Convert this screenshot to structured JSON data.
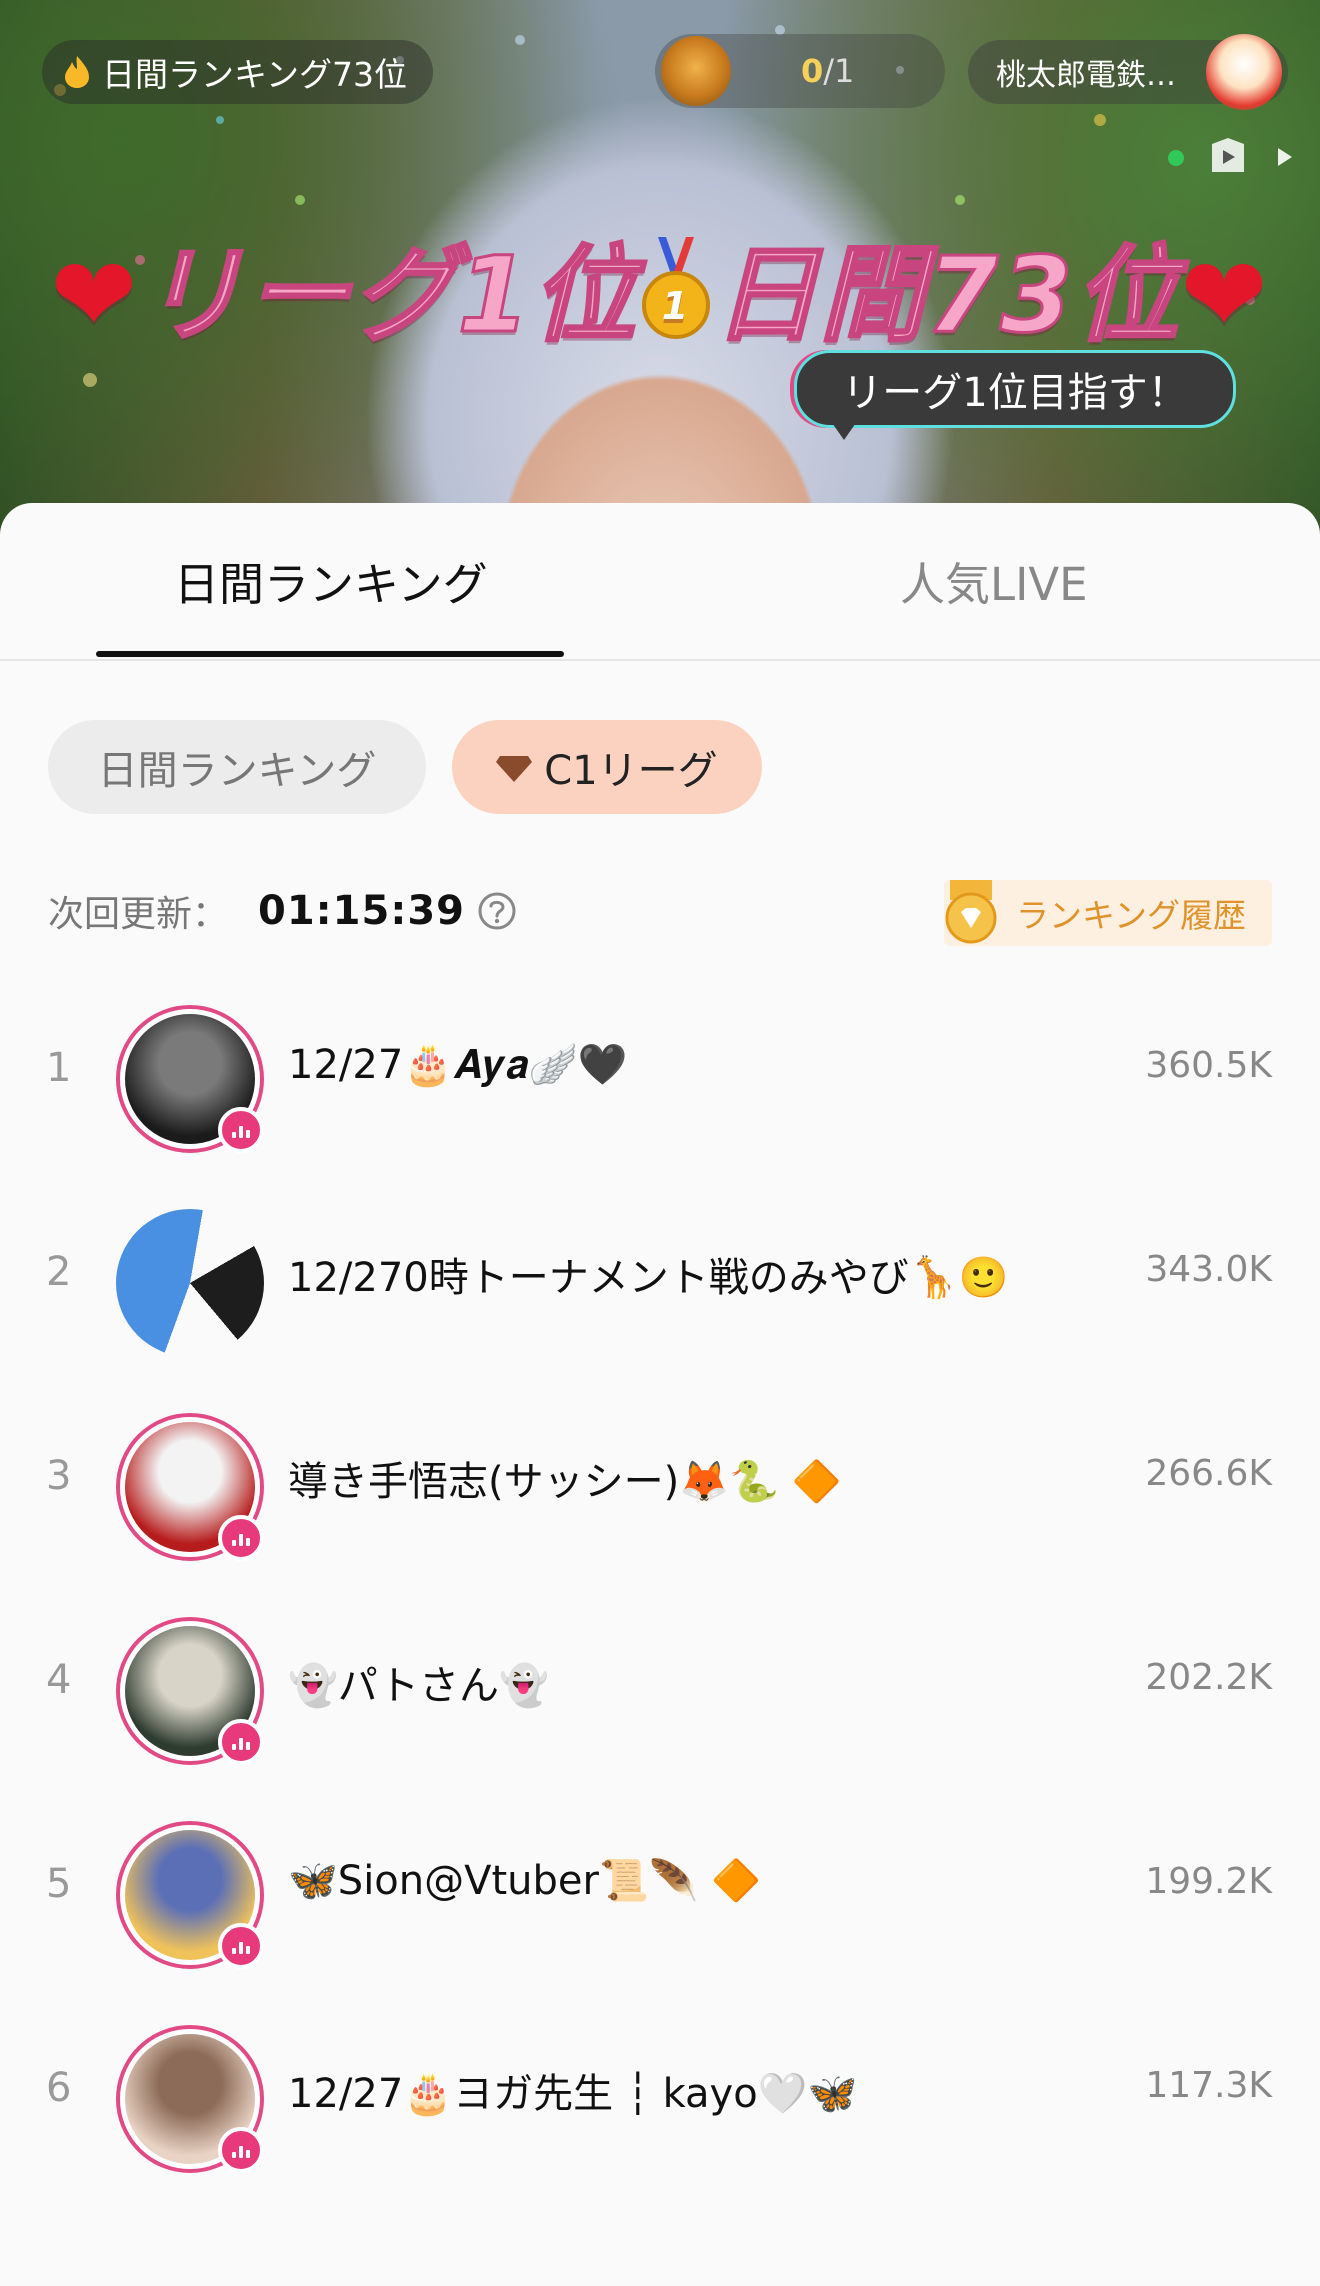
{
  "stream": {
    "rank_pill": "日間ランキング73位",
    "gift_count": "0",
    "gift_total": "/1",
    "game_pill": "桃太郎電鉄…",
    "banner_left": "リーグ1位",
    "banner_right": "日間73位",
    "bubble": "リーグ1位目指す！"
  },
  "tabs": {
    "daily": "日間ランキング",
    "popular": "人気LIVE"
  },
  "chips": {
    "daily": "日間ランキング",
    "c1": "C1リーグ"
  },
  "update": {
    "label": "次回更新：",
    "time": "01:15:39"
  },
  "history": {
    "label": "ランキング履歴"
  },
  "ranking": [
    {
      "rank": "1",
      "name": "12/27🎂𝑨𝒚𝒂🪽🖤",
      "score": "360.5K",
      "ring": true,
      "avatar": [
        "#1b1b1b",
        "#7a7a7a"
      ]
    },
    {
      "rank": "2",
      "name": "12/270時トーナメント戦のみやび🦒🙂",
      "score": "343.0K",
      "ring": false,
      "avatar": [
        "#4a90e2",
        "#1d1d1d"
      ]
    },
    {
      "rank": "3",
      "name": "導き手悟志(サッシー)🦊🐍 🔶",
      "score": "266.6K",
      "ring": true,
      "avatar": [
        "#b71c1c",
        "#f3f3f3"
      ]
    },
    {
      "rank": "4",
      "name": "👻パトさん👻",
      "score": "202.2K",
      "ring": true,
      "avatar": [
        "#2e3b2f",
        "#d9d4c8"
      ]
    },
    {
      "rank": "5",
      "name": "🦋Sion@Vtuber📜🪶 🔶",
      "score": "199.2K",
      "ring": true,
      "avatar": [
        "#f0c35a",
        "#5b6fb7"
      ]
    },
    {
      "rank": "6",
      "name": "12/27🎂ヨガ先生 ┆ kayo🤍🦋",
      "score": "117.3K",
      "ring": true,
      "avatar": [
        "#e9d3c4",
        "#8c6b58"
      ]
    }
  ],
  "colors": {
    "accent_pink": "#e24a86",
    "chip_active_bg": "#fbd2c0",
    "history_gold": "#e0932b"
  }
}
